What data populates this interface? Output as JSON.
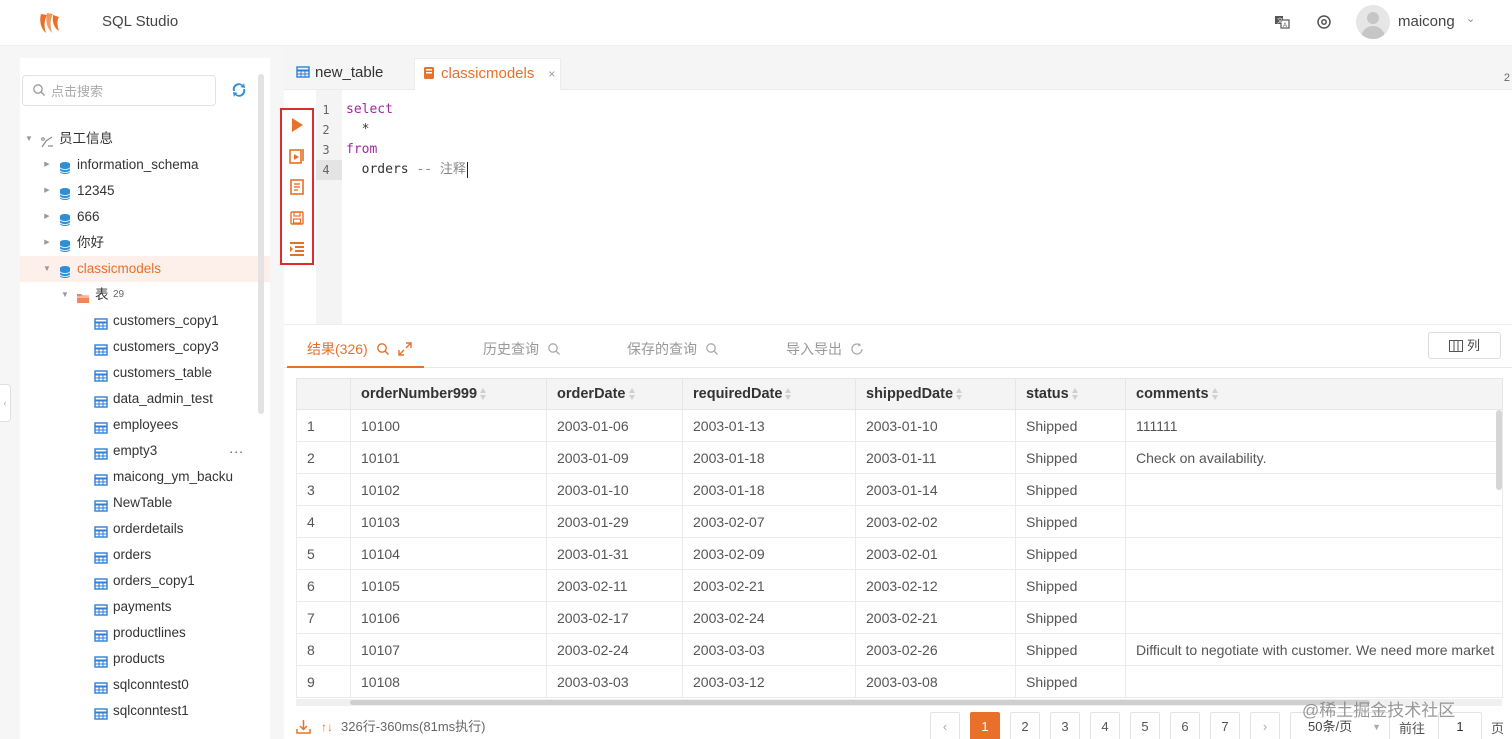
{
  "header": {
    "app_title": "SQL Studio",
    "username": "maicong"
  },
  "sidebar": {
    "search_placeholder": "点击搜索",
    "tree": [
      {
        "label": "员工信息",
        "level": 0,
        "icon": "connection-icon",
        "arrow": "down"
      },
      {
        "label": "information_schema",
        "level": 1,
        "icon": "database-icon",
        "arrow": "right"
      },
      {
        "label": "12345",
        "level": 1,
        "icon": "database-icon",
        "arrow": "right"
      },
      {
        "label": "666",
        "level": 1,
        "icon": "database-icon",
        "arrow": "right"
      },
      {
        "label": "你好",
        "level": 1,
        "icon": "database-icon",
        "arrow": "right"
      },
      {
        "label": "classicmodels",
        "level": 1,
        "icon": "database-icon",
        "arrow": "down",
        "selected": true
      },
      {
        "label": "表",
        "badge": "29",
        "level": 2,
        "icon": "folder-icon",
        "arrow": "down"
      },
      {
        "label": "customers_copy1",
        "level": 3,
        "icon": "table-icon"
      },
      {
        "label": "customers_copy3",
        "level": 3,
        "icon": "table-icon"
      },
      {
        "label": "customers_table",
        "level": 3,
        "icon": "table-icon"
      },
      {
        "label": "data_admin_test",
        "level": 3,
        "icon": "table-icon"
      },
      {
        "label": "employees",
        "level": 3,
        "icon": "table-icon"
      },
      {
        "label": "empty3",
        "level": 3,
        "icon": "table-icon",
        "more": "..."
      },
      {
        "label": "maicong_ym_backu",
        "level": 3,
        "icon": "table-icon"
      },
      {
        "label": "NewTable",
        "level": 3,
        "icon": "table-icon"
      },
      {
        "label": "orderdetails",
        "level": 3,
        "icon": "table-icon"
      },
      {
        "label": "orders",
        "level": 3,
        "icon": "table-icon"
      },
      {
        "label": "orders_copy1",
        "level": 3,
        "icon": "table-icon"
      },
      {
        "label": "payments",
        "level": 3,
        "icon": "table-icon"
      },
      {
        "label": "productlines",
        "level": 3,
        "icon": "table-icon"
      },
      {
        "label": "products",
        "level": 3,
        "icon": "table-icon"
      },
      {
        "label": "sqlconntest0",
        "level": 3,
        "icon": "table-icon"
      },
      {
        "label": "sqlconntest1",
        "level": 3,
        "icon": "table-icon"
      }
    ]
  },
  "tabs": [
    {
      "label": "new_table",
      "icon": "table-icon",
      "active": false
    },
    {
      "label": "classicmodels",
      "icon": "database-icon",
      "active": true,
      "close": "×"
    }
  ],
  "tab_edge_number": "2",
  "editor": {
    "toolbar": [
      "run-icon",
      "run-selected-icon",
      "explain-icon",
      "save-icon",
      "format-icon"
    ],
    "line_numbers": [
      "1",
      "2",
      "3",
      "4"
    ],
    "lines": [
      {
        "keyword": "select",
        "text": ""
      },
      {
        "keyword": "",
        "text": "  *"
      },
      {
        "keyword": "from",
        "text": ""
      },
      {
        "keyword": "",
        "text": "  orders ",
        "comment": "-- 注释"
      }
    ]
  },
  "results": {
    "tabs": [
      {
        "label": "结果(326)",
        "active": true
      },
      {
        "label": "历史查询",
        "active": false
      },
      {
        "label": "保存的查询",
        "active": false
      },
      {
        "label": "导入导出",
        "active": false
      }
    ],
    "columns_button": "列",
    "columns": [
      "orderNumber999",
      "orderDate",
      "requiredDate",
      "shippedDate",
      "status",
      "comments"
    ],
    "rows": [
      [
        "1",
        "10100",
        "2003-01-06",
        "2003-01-13",
        "2003-01-10",
        "Shipped",
        "111111"
      ],
      [
        "2",
        "10101",
        "2003-01-09",
        "2003-01-18",
        "2003-01-11",
        "Shipped",
        "Check on availability."
      ],
      [
        "3",
        "10102",
        "2003-01-10",
        "2003-01-18",
        "2003-01-14",
        "Shipped",
        ""
      ],
      [
        "4",
        "10103",
        "2003-01-29",
        "2003-02-07",
        "2003-02-02",
        "Shipped",
        ""
      ],
      [
        "5",
        "10104",
        "2003-01-31",
        "2003-02-09",
        "2003-02-01",
        "Shipped",
        ""
      ],
      [
        "6",
        "10105",
        "2003-02-11",
        "2003-02-21",
        "2003-02-12",
        "Shipped",
        ""
      ],
      [
        "7",
        "10106",
        "2003-02-17",
        "2003-02-24",
        "2003-02-21",
        "Shipped",
        ""
      ],
      [
        "8",
        "10107",
        "2003-02-24",
        "2003-03-03",
        "2003-02-26",
        "Shipped",
        "Difficult to negotiate with customer. We need more market"
      ],
      [
        "9",
        "10108",
        "2003-03-03",
        "2003-03-12",
        "2003-03-08",
        "Shipped",
        ""
      ]
    ],
    "status": "326行-360ms(81ms执行)",
    "pagination": {
      "prev": "‹",
      "pages": [
        "1",
        "2",
        "3",
        "4",
        "5",
        "6",
        "7"
      ],
      "current": "1",
      "next": "›",
      "page_size": "50条/页",
      "goto_label": "前往",
      "goto_value": "1",
      "page_suffix": "页"
    }
  },
  "watermark": "@稀土掘金技术社区",
  "colors": {
    "accent": "#e8702a",
    "toolbar_highlight": "#e02b2b",
    "table_icon": "#2f7fd6",
    "database_icon": "#2f8fd6"
  }
}
